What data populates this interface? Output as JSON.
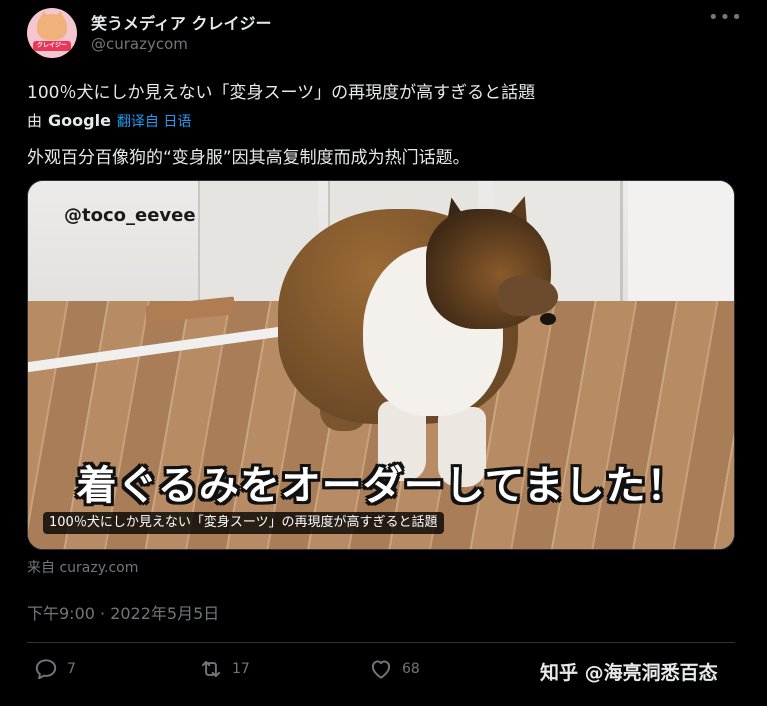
{
  "account": {
    "display_name": "笑うメディア クレイジー",
    "handle": "@curazycom",
    "avatar_label": "クレイジー",
    "more_label": "•••"
  },
  "tweet": {
    "text": "100％犬にしか見えない「変身スーツ」の再現度が高すぎると話題",
    "translated_by_prefix": "由",
    "translated_by_brand": "Google",
    "translate_link": "翻译自 日语",
    "translated_text": "外观百分百像狗的“变身服”因其高复制度而成为热门话题。",
    "source": "来自 curazy.com",
    "timestamp": "下午9:00 · 2022年5月5日"
  },
  "media": {
    "watermark": "@toco_eevee",
    "caption": "着ぐるみをオーダーしてました！",
    "card_title": "100％犬にしか見えない「変身スーツ」の再現度が高すぎると話題"
  },
  "actions": {
    "reply_count": "7",
    "retweet_count": "17",
    "like_count": "68"
  },
  "overlay": {
    "zhihu_watermark": "知乎 @海亮洞悉百态"
  },
  "colors": {
    "background": "#000000",
    "text_primary": "#e7e9ea",
    "text_secondary": "#71767b",
    "link": "#1d9bf0",
    "divider": "#2f3336"
  }
}
